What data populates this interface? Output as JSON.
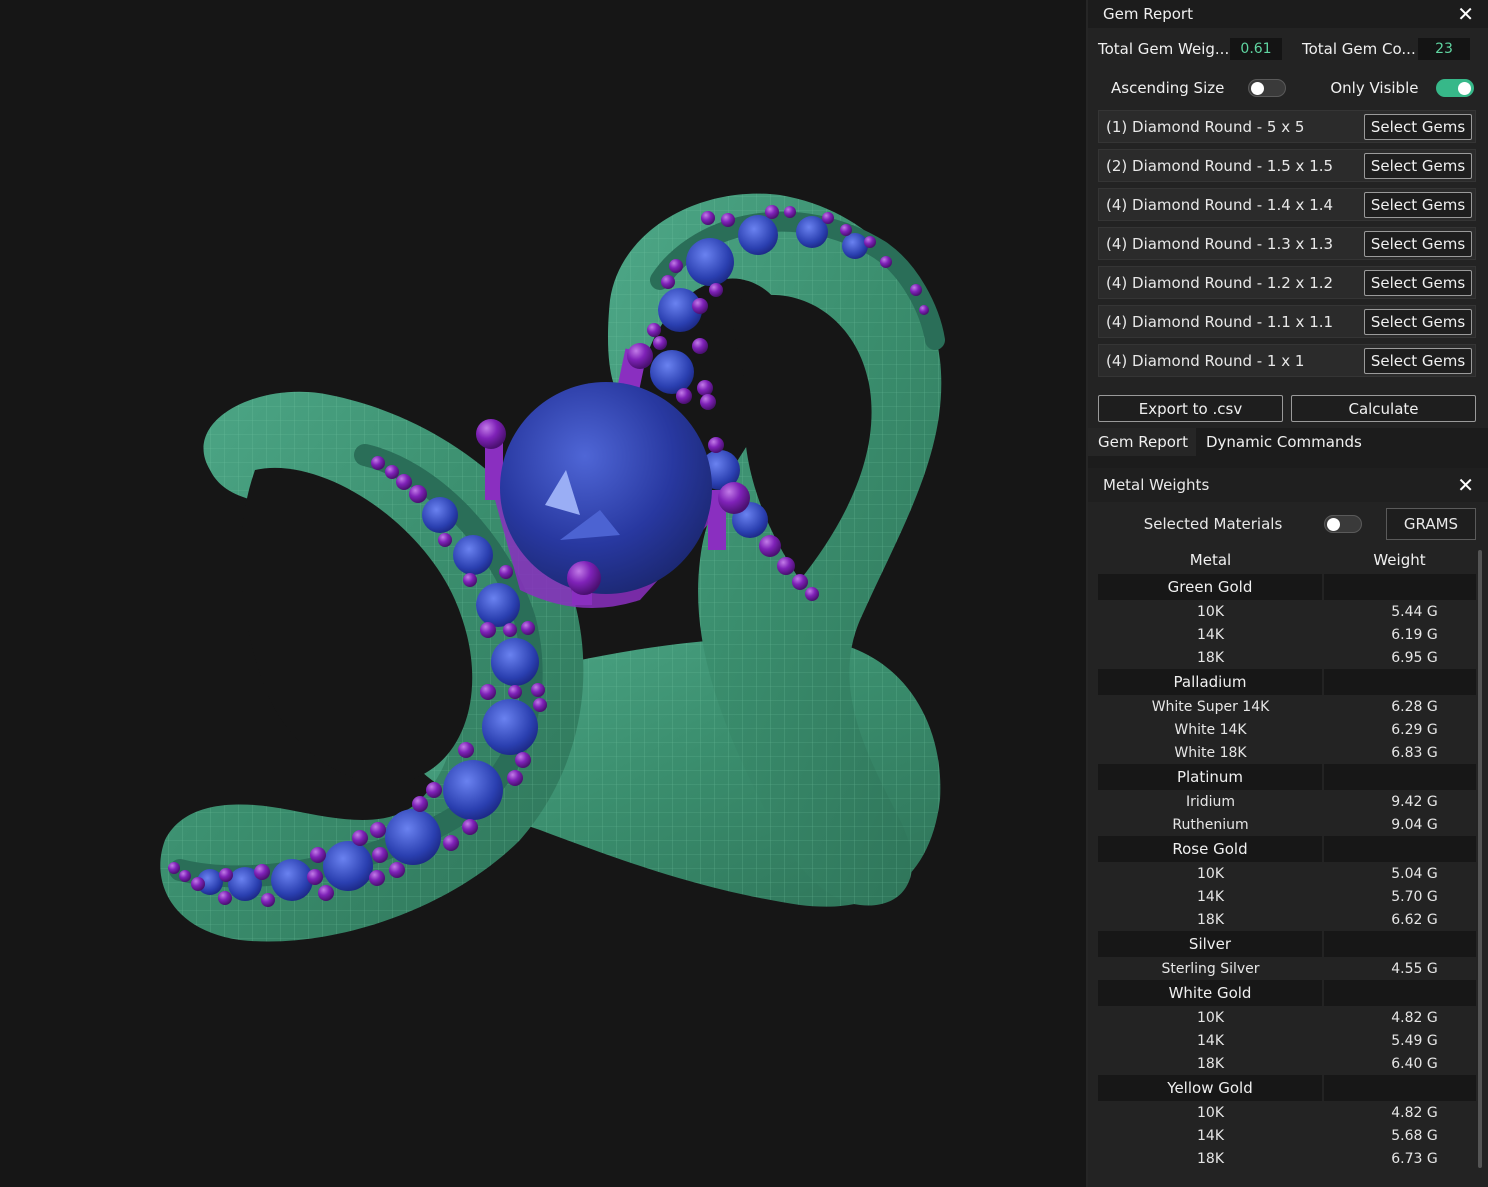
{
  "gem_report": {
    "title": "Gem Report",
    "total_weight_label": "Total Gem Weig...",
    "total_weight_value": "0.61",
    "total_count_label": "Total Gem Co...",
    "total_count_value": "23",
    "ascending_label": "Ascending Size",
    "ascending_on": false,
    "visible_label": "Only Visible",
    "visible_on": true,
    "select_label": "Select Gems",
    "gems": [
      "(1) Diamond Round - 5 x 5",
      "(2) Diamond Round - 1.5 x 1.5",
      "(4) Diamond Round - 1.4 x 1.4",
      "(4) Diamond Round - 1.3 x 1.3",
      "(4) Diamond Round - 1.2 x 1.2",
      "(4) Diamond Round - 1.1 x 1.1",
      "(4) Diamond Round - 1 x 1"
    ],
    "export_label": "Export to .csv",
    "calculate_label": "Calculate"
  },
  "tabs": [
    "Gem Report",
    "Dynamic Commands"
  ],
  "metal_weights": {
    "title": "Metal Weights",
    "selected_label": "Selected Materials",
    "selected_on": false,
    "units_label": "GRAMS",
    "col_metal": "Metal",
    "col_weight": "Weight",
    "groups": [
      {
        "name": "Green Gold",
        "rows": [
          [
            "10K",
            "5.44 G"
          ],
          [
            "14K",
            "6.19 G"
          ],
          [
            "18K",
            "6.95 G"
          ]
        ]
      },
      {
        "name": "Palladium",
        "rows": [
          [
            "White Super 14K",
            "6.28 G"
          ],
          [
            "White 14K",
            "6.29 G"
          ],
          [
            "White 18K",
            "6.83 G"
          ]
        ]
      },
      {
        "name": "Platinum",
        "rows": [
          [
            "Iridium",
            "9.42 G"
          ],
          [
            "Ruthenium",
            "9.04 G"
          ]
        ]
      },
      {
        "name": "Rose Gold",
        "rows": [
          [
            "10K",
            "5.04 G"
          ],
          [
            "14K",
            "5.70 G"
          ],
          [
            "18K",
            "6.62 G"
          ]
        ]
      },
      {
        "name": "Silver",
        "rows": [
          [
            "Sterling Silver",
            "4.55 G"
          ]
        ]
      },
      {
        "name": "White Gold",
        "rows": [
          [
            "10K",
            "4.82 G"
          ],
          [
            "14K",
            "5.49 G"
          ],
          [
            "18K",
            "6.40 G"
          ]
        ]
      },
      {
        "name": "Yellow Gold",
        "rows": [
          [
            "10K",
            "4.82 G"
          ],
          [
            "14K",
            "5.68 G"
          ],
          [
            "18K",
            "6.73 G"
          ]
        ]
      }
    ]
  },
  "colors": {
    "metal": "#3f9a76",
    "gem": "#2a3fa8",
    "prong": "#8a2fc0",
    "accent": "#5fd4a0"
  }
}
